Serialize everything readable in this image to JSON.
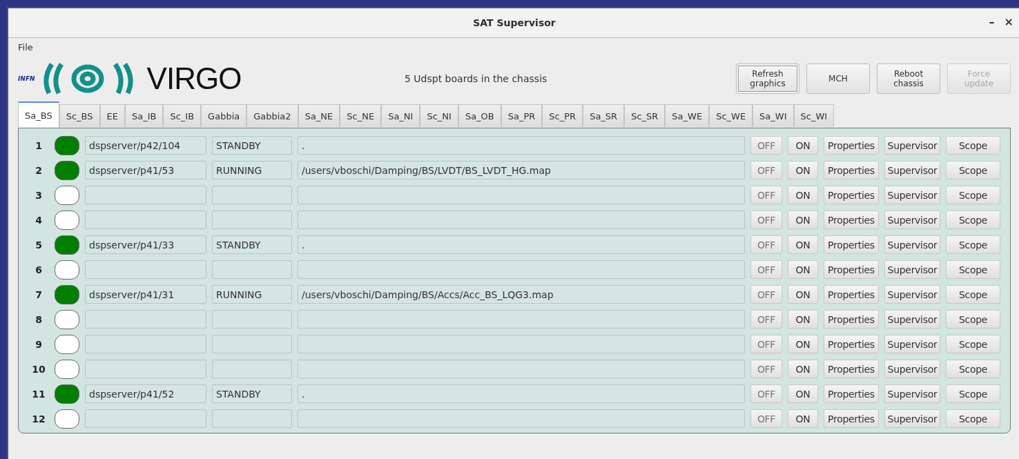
{
  "window": {
    "title": "SAT Supervisor",
    "controls": [
      "–",
      "×"
    ]
  },
  "menu": [
    "File"
  ],
  "logo": {
    "small": "INFN",
    "name": "VIRGO"
  },
  "info": "5 Udspt boards in the chassis",
  "buttons": [
    {
      "label": "Refresh graphics",
      "disabled": false,
      "focused": true
    },
    {
      "label": "MCH",
      "disabled": false,
      "focused": false
    },
    {
      "label": "Reboot chassis",
      "disabled": false,
      "focused": false
    },
    {
      "label": "Force update",
      "disabled": true,
      "focused": false
    }
  ],
  "tabs": [
    {
      "label": "Sa_BS",
      "selected": true
    },
    {
      "label": "Sc_BS",
      "selected": false
    },
    {
      "label": "EE",
      "selected": false
    },
    {
      "label": "Sa_IB",
      "selected": false
    },
    {
      "label": "Sc_IB",
      "selected": false
    },
    {
      "label": "Gabbia",
      "selected": false
    },
    {
      "label": "Gabbia2",
      "selected": false
    },
    {
      "label": "Sa_NE",
      "selected": false
    },
    {
      "label": "Sc_NE",
      "selected": false
    },
    {
      "label": "Sa_NI",
      "selected": false
    },
    {
      "label": "Sc_NI",
      "selected": false
    },
    {
      "label": "Sa_OB",
      "selected": false
    },
    {
      "label": "Sa_PR",
      "selected": false
    },
    {
      "label": "Sc_PR",
      "selected": false
    },
    {
      "label": "Sa_SR",
      "selected": false
    },
    {
      "label": "Sc_SR",
      "selected": false
    },
    {
      "label": "Sa_WE",
      "selected": false
    },
    {
      "label": "Sc_WE",
      "selected": false
    },
    {
      "label": "Sa_WI",
      "selected": false
    },
    {
      "label": "Sc_WI",
      "selected": false
    }
  ],
  "rows": [
    {
      "number": "1",
      "color": "#007f00",
      "server": "dspserver/p42/104",
      "state": "STANDBY",
      "path": ".",
      "actions": [
        "OFF",
        "ON",
        "Properties",
        "Supervisor",
        "Scope"
      ]
    },
    {
      "number": "2",
      "color": "#007f00",
      "server": "dspserver/p41/53",
      "state": "RUNNING",
      "path": "/users/vboschi/Damping/BS/LVDT/BS_LVDT_HG.map",
      "actions": [
        "OFF",
        "ON",
        "Properties",
        "Supervisor",
        "Scope"
      ]
    },
    {
      "number": "3",
      "color": "#ffffff",
      "actions": [
        "OFF",
        "ON",
        "Properties",
        "Supervisor",
        "Scope"
      ]
    },
    {
      "number": "4",
      "color": "#ffffff",
      "actions": [
        "OFF",
        "ON",
        "Properties",
        "Supervisor",
        "Scope"
      ]
    },
    {
      "number": "5",
      "color": "#007f00",
      "server": "dspserver/p41/33",
      "state": "STANDBY",
      "path": ".",
      "actions": [
        "OFF",
        "ON",
        "Properties",
        "Supervisor",
        "Scope"
      ]
    },
    {
      "number": "6",
      "color": "#ffffff",
      "actions": [
        "OFF",
        "ON",
        "Properties",
        "Supervisor",
        "Scope"
      ]
    },
    {
      "number": "7",
      "color": "#007f00",
      "server": "dspserver/p41/31",
      "state": "RUNNING",
      "path": "/users/vboschi/Damping/BS/Accs/Acc_BS_LQG3.map",
      "actions": [
        "OFF",
        "ON",
        "Properties",
        "Supervisor",
        "Scope"
      ]
    },
    {
      "number": "8",
      "color": "#ffffff",
      "actions": [
        "OFF",
        "ON",
        "Properties",
        "Supervisor",
        "Scope"
      ]
    },
    {
      "number": "9",
      "color": "#ffffff",
      "actions": [
        "OFF",
        "ON",
        "Properties",
        "Supervisor",
        "Scope"
      ]
    },
    {
      "number": "10",
      "color": "#ffffff",
      "actions": [
        "OFF",
        "ON",
        "Properties",
        "Supervisor",
        "Scope"
      ]
    },
    {
      "number": "11",
      "color": "#007f00",
      "server": "dspserver/p41/52",
      "state": "STANDBY",
      "path": ".",
      "actions": [
        "OFF",
        "ON",
        "Properties",
        "Supervisor",
        "Scope"
      ]
    },
    {
      "number": "12",
      "color": "#ffffff",
      "actions": [
        "OFF",
        "ON",
        "Properties",
        "Supervisor",
        "Scope"
      ]
    }
  ]
}
